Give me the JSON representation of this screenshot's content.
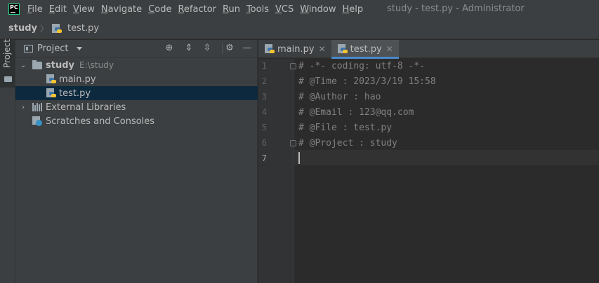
{
  "menubar": {
    "logo_text": "PC",
    "items": [
      "File",
      "Edit",
      "View",
      "Navigate",
      "Code",
      "Refactor",
      "Run",
      "Tools",
      "VCS",
      "Window",
      "Help"
    ],
    "window_title": "study - test.py - Administrator"
  },
  "navbar": {
    "project": "study",
    "file": "test.py"
  },
  "toolstrip": {
    "project_tab": "Project"
  },
  "project_panel": {
    "title": "Project",
    "tree": [
      {
        "label": "study",
        "hint": "E:\\study"
      },
      {
        "label": "main.py"
      },
      {
        "label": "test.py"
      },
      {
        "label": "External Libraries"
      },
      {
        "label": "Scratches and Consoles"
      }
    ],
    "icons": [
      "locate-icon",
      "expand-all-icon",
      "collapse-all-icon",
      "gear-icon",
      "minimize-icon"
    ]
  },
  "editor": {
    "tabs": [
      {
        "label": "main.py",
        "active": false
      },
      {
        "label": "test.py",
        "active": true
      }
    ],
    "lines": [
      {
        "num": "1",
        "text": "# -*- coding: utf-8 -*-"
      },
      {
        "num": "2",
        "text": "# @Time : 2023/3/19 15:58"
      },
      {
        "num": "3",
        "text": "# @Author : hao"
      },
      {
        "num": "4",
        "text": "# @Email : 123@qq.com"
      },
      {
        "num": "5",
        "text": "# @File : test.py"
      },
      {
        "num": "6",
        "text": "# @Project : study"
      },
      {
        "num": "7",
        "text": ""
      }
    ],
    "current_line": 7
  },
  "colors": {
    "background": "#2b2b2b",
    "panel": "#3c3f41",
    "selection": "#0d293e",
    "accent": "#4a88c7",
    "comment": "#808080"
  }
}
